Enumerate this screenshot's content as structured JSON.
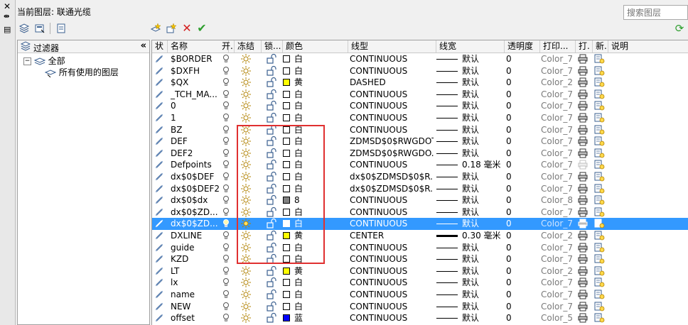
{
  "header": {
    "current_layer_label": "当前图层: 联通光缆",
    "search_placeholder": "搜索图层"
  },
  "filter_panel": {
    "title": "过滤器",
    "collapse": "«",
    "tree": [
      {
        "label": "全部",
        "expanded": true
      },
      {
        "label": "所有使用的图层"
      }
    ]
  },
  "columns": [
    "状",
    "名称",
    "开.",
    "冻结",
    "锁...",
    "颜色",
    "线型",
    "线宽",
    "透明度",
    "打印...",
    "打.",
    "新.",
    "说明"
  ],
  "colors": {
    "accent": "#3399ff",
    "highlight_box": "#e03030",
    "yellow": "#ffff00",
    "blue": "#0000ff",
    "gray8": "#808080"
  },
  "rows": [
    {
      "name": "$BORDER",
      "color": "白",
      "swatch": "#ffffff",
      "linetype": "CONTINUOUS",
      "lw": "默认",
      "transparency": "0",
      "plot_style": "Color_7"
    },
    {
      "name": "$DXFH",
      "color": "白",
      "swatch": "#ffffff",
      "linetype": "CONTINUOUS",
      "lw": "默认",
      "transparency": "0",
      "plot_style": "Color_7"
    },
    {
      "name": "$QX",
      "color": "黄",
      "swatch": "#ffff00",
      "linetype": "DASHED",
      "lw": "默认",
      "transparency": "0",
      "plot_style": "Color_2"
    },
    {
      "name": "_TCH_MA...",
      "color": "白",
      "swatch": "#ffffff",
      "linetype": "CONTINUOUS",
      "lw": "默认",
      "transparency": "0",
      "plot_style": "Color_7"
    },
    {
      "name": "0",
      "color": "白",
      "swatch": "#ffffff",
      "linetype": "CONTINUOUS",
      "lw": "默认",
      "transparency": "0",
      "plot_style": "Color_7"
    },
    {
      "name": "1",
      "color": "白",
      "swatch": "#ffffff",
      "linetype": "CONTINUOUS",
      "lw": "默认",
      "transparency": "0",
      "plot_style": "Color_7"
    },
    {
      "name": "BZ",
      "color": "白",
      "swatch": "#ffffff",
      "linetype": "CONTINUOUS",
      "lw": "默认",
      "transparency": "0",
      "plot_style": "Color_7"
    },
    {
      "name": "DEF",
      "color": "白",
      "swatch": "#ffffff",
      "linetype": "ZDMSD$0$RWGDOT",
      "lw": "默认",
      "transparency": "0",
      "plot_style": "Color_7"
    },
    {
      "name": "DEF2",
      "color": "白",
      "swatch": "#ffffff",
      "linetype": "ZDMSD$0$RWGDO...",
      "lw": "默认",
      "transparency": "0",
      "plot_style": "Color_7"
    },
    {
      "name": "Defpoints",
      "color": "白",
      "swatch": "#ffffff",
      "linetype": "CONTINUOUS",
      "lw": "0.18 毫米",
      "transparency": "0",
      "plot_style": "Color_7",
      "noplot": true
    },
    {
      "name": "dx$0$DEF",
      "color": "白",
      "swatch": "#ffffff",
      "linetype": "dx$0$ZDMSD$0$R...",
      "lw": "默认",
      "transparency": "0",
      "plot_style": "Color_7"
    },
    {
      "name": "dx$0$DEF2",
      "color": "白",
      "swatch": "#ffffff",
      "linetype": "dx$0$ZDMSD$0$R...",
      "lw": "默认",
      "transparency": "0",
      "plot_style": "Color_7"
    },
    {
      "name": "dx$0$dx",
      "color": "8",
      "swatch": "#808080",
      "linetype": "CONTINUOUS",
      "lw": "默认",
      "transparency": "0",
      "plot_style": "Color_8"
    },
    {
      "name": "dx$0$ZD...",
      "color": "白",
      "swatch": "#ffffff",
      "linetype": "CONTINUOUS",
      "lw": "默认",
      "transparency": "0",
      "plot_style": "Color_7"
    },
    {
      "name": "dx$0$ZD...",
      "color": "白",
      "swatch": "#ffffff",
      "linetype": "CONTINUOUS",
      "lw": "默认",
      "transparency": "0",
      "plot_style": "Color_7",
      "selected": true
    },
    {
      "name": "DXLINE",
      "color": "黄",
      "swatch": "#ffff00",
      "linetype": "CENTER",
      "lw": "0.30 毫米",
      "transparency": "0",
      "plot_style": "Color_2",
      "thick": true
    },
    {
      "name": "guide",
      "color": "白",
      "swatch": "#ffffff",
      "linetype": "CONTINUOUS",
      "lw": "默认",
      "transparency": "0",
      "plot_style": "Color_7"
    },
    {
      "name": "KZD",
      "color": "白",
      "swatch": "#ffffff",
      "linetype": "CONTINUOUS",
      "lw": "默认",
      "transparency": "0",
      "plot_style": "Color_7"
    },
    {
      "name": "LT",
      "color": "黄",
      "swatch": "#ffff00",
      "linetype": "CONTINUOUS",
      "lw": "默认",
      "transparency": "0",
      "plot_style": "Color_2"
    },
    {
      "name": "lx",
      "color": "白",
      "swatch": "#ffffff",
      "linetype": "CONTINUOUS",
      "lw": "默认",
      "transparency": "0",
      "plot_style": "Color_7"
    },
    {
      "name": "name",
      "color": "白",
      "swatch": "#ffffff",
      "linetype": "CONTINUOUS",
      "lw": "默认",
      "transparency": "0",
      "plot_style": "Color_7"
    },
    {
      "name": "NEW",
      "color": "白",
      "swatch": "#ffffff",
      "linetype": "CONTINUOUS",
      "lw": "默认",
      "transparency": "0",
      "plot_style": "Color_7"
    },
    {
      "name": "offset",
      "color": "蓝",
      "swatch": "#0000ff",
      "linetype": "CONTINUOUS",
      "lw": "默认",
      "transparency": "0",
      "plot_style": "Color_5"
    }
  ]
}
